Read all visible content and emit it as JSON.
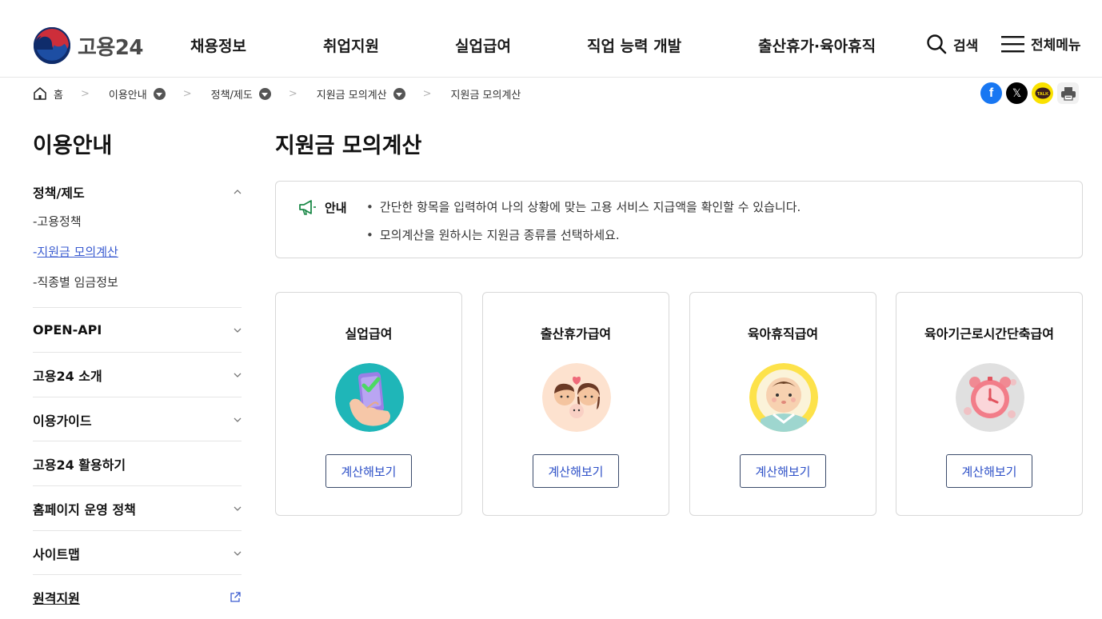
{
  "header": {
    "logo_text": "고용24",
    "nav": [
      "채용정보",
      "취업지원",
      "실업급여",
      "직업 능력 개발",
      "출산휴가·육아휴직"
    ],
    "search_label": "검색",
    "menu_label": "전체메뉴"
  },
  "breadcrumb": {
    "home": "홈",
    "items": [
      "이용안내",
      "정책/제도",
      "지원금 모의계산"
    ],
    "current": "지원금 모의계산"
  },
  "share": {
    "facebook_icon": "f",
    "x_icon": "𝕏",
    "kakao_icon": "TALK"
  },
  "sidebar": {
    "title": "이용안내",
    "group": {
      "label": "정책/제도",
      "items": [
        "고용정책",
        "지원금 모의계산",
        "직종별 임금정보"
      ],
      "active_index": 1
    },
    "sections": [
      "OPEN-API",
      "고용24 소개",
      "이용가이드",
      "고용24 활용하기",
      "홈페이지 운영 정책",
      "사이트맵",
      "원격지원"
    ]
  },
  "main": {
    "title": "지원금 모의계산",
    "notice": {
      "label": "안내",
      "lines": [
        "간단한 항목을 입력하여 나의 상황에 맞는 고용 서비스 지급액을 확인할 수 있습니다.",
        "모의계산을 원하시는 지원금 종류를 선택하세요."
      ]
    },
    "cards": [
      {
        "title": "실업급여",
        "button": "계산해보기",
        "icon": "phone-check-icon"
      },
      {
        "title": "출산휴가급여",
        "button": "계산해보기",
        "icon": "family-icon"
      },
      {
        "title": "육아휴직급여",
        "button": "계산해보기",
        "icon": "baby-icon"
      },
      {
        "title": "육아기근로시간단축급여",
        "button": "계산해보기",
        "icon": "alarm-clock-icon"
      }
    ]
  },
  "colors": {
    "link_active": "#3a5bd0",
    "button_text": "#2c4fc7",
    "notice_icon": "#1e8a4a"
  }
}
